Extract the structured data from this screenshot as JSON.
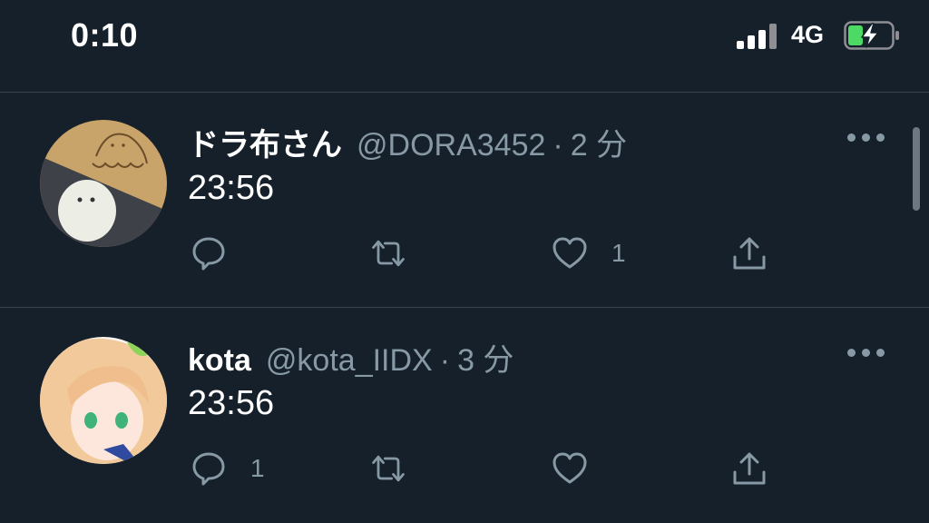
{
  "status": {
    "time": "0:10",
    "network": "4G"
  },
  "tweets": [
    {
      "display_name": "ドラ布さん",
      "handle": "@DORA3452",
      "separator": "·",
      "time": "2 分",
      "text": "23:56",
      "reply_count": "",
      "retweet_count": "",
      "like_count": "1"
    },
    {
      "display_name": "kota",
      "handle": "@kota_IIDX",
      "separator": "·",
      "time": "3 分",
      "text": "23:56",
      "reply_count": "1",
      "retweet_count": "",
      "like_count": ""
    }
  ],
  "colors": {
    "background": "#15202b",
    "secondary_text": "#8899a6",
    "divider": "#38444d",
    "battery_green": "#4cd964"
  },
  "icons": [
    "signal-icon",
    "battery-charging-icon",
    "more-icon",
    "reply-icon",
    "retweet-icon",
    "like-icon",
    "share-icon"
  ]
}
